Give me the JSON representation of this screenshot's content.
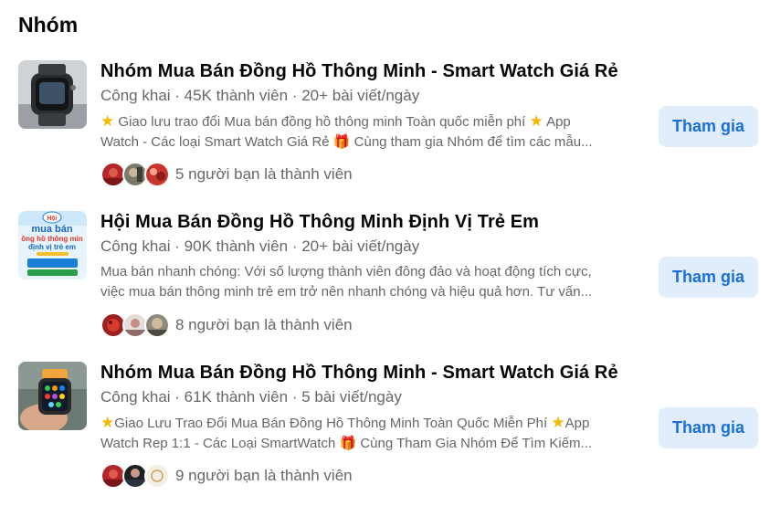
{
  "section": {
    "title": "Nhóm"
  },
  "groups": [
    {
      "name": "Nhóm Mua Bán Đồng Hồ Thông Minh - Smart Watch Giá Rẻ",
      "privacy": "Công khai",
      "members": "45K thành viên",
      "posts": "20+ bài viết/ngày",
      "separator": " · ",
      "desc_line1": " Giao lưu trao đổi Mua bán đồng hồ thông minh Toàn quốc miễn phí ",
      "desc_line1_end": " App",
      "desc_line2": "Watch - Các loại Smart Watch Giá Rẻ ",
      "desc_line2_end": " Cùng tham gia Nhóm để tìm các mẫu...",
      "friends": "5 người bạn là thành viên",
      "join_label": "Tham gia",
      "thumb_icon": "smartwatch-photo"
    },
    {
      "name": "Hội Mua Bán Đồng Hồ Thông Minh Định Vị Trẻ Em",
      "privacy": "Công khai",
      "members": "90K thành viên",
      "posts": "20+ bài viết/ngày",
      "separator": " · ",
      "desc_line1": "Mua bán nhanh chóng: Với số lượng thành viên đông đảo và hoạt động tích cực,",
      "desc_line2": "việc mua bán thông minh trẻ em trở nên nhanh chóng và hiệu quả hơn. Tư vấn...",
      "friends": "8 người bạn là thành viên",
      "join_label": "Tham gia",
      "thumb_text_1": "Hội",
      "thumb_text_2": "mua bán",
      "thumb_text_3": "ồng hồ thông min",
      "thumb_text_4": "định vị trẻ em",
      "thumb_icon": "kids-watch-banner"
    },
    {
      "name": "Nhóm Mua Bán Đồng Hồ Thông Minh - Smart Watch Giá Rẻ",
      "privacy": "Công khai",
      "members": "61K thành viên",
      "posts": "5 bài viết/ngày",
      "separator": " · ",
      "desc_line1": "Giao Lưu Trao Đổi Mua Bán Đồng Hồ Thông Minh Toàn Quốc Miễn Phí ",
      "desc_line1_end": "App",
      "desc_line2": "Watch Rep 1:1 - Các Loại SmartWatch ",
      "desc_line2_end": " Cùng Tham Gia Nhóm Để Tìm Kiếm...",
      "friends": "9 người bạn là thành viên",
      "join_label": "Tham gia",
      "thumb_icon": "hand-holding-watch-photo"
    }
  ],
  "colors": {
    "accent": "#1a6ed8",
    "button_bg": "#e1edfb",
    "secondary_text": "#65676b",
    "star": "#f5b800"
  }
}
